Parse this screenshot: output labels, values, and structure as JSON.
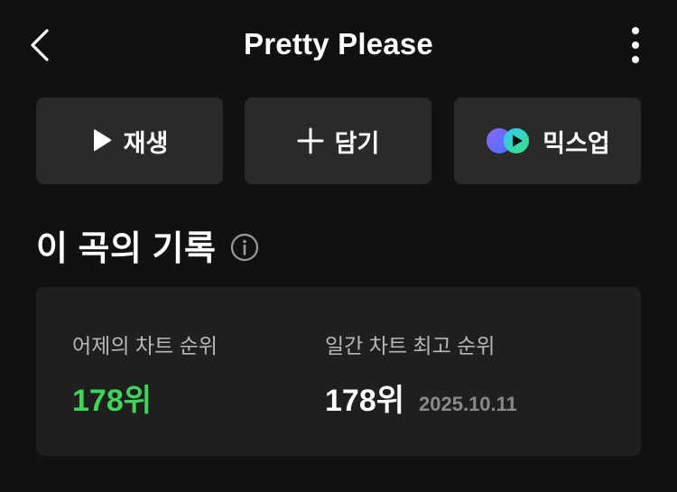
{
  "header": {
    "title": "Pretty Please",
    "back_icon": "chevron-left-icon",
    "more_icon": "more-vertical-icon"
  },
  "actions": [
    {
      "label": "재생",
      "icon": "play-icon"
    },
    {
      "label": "담기",
      "icon": "plus-icon"
    },
    {
      "label": "믹스업",
      "icon": "mixup-icon"
    }
  ],
  "section": {
    "title": "이 곡의 기록",
    "info_icon": "info-icon"
  },
  "record": {
    "yesterday_label": "어제의 차트 순위",
    "yesterday_value": "178위",
    "best_label": "일간 차트 최고 순위",
    "best_value": "178위",
    "best_date": "2025.10.11"
  },
  "colors": {
    "background": "#111111",
    "button_bg": "#2a2a2a",
    "card_bg": "#1f1f1f",
    "accent_green": "#3fd55b",
    "mixup_purple": "#6a5cff",
    "mixup_green": "#3fe07a"
  }
}
